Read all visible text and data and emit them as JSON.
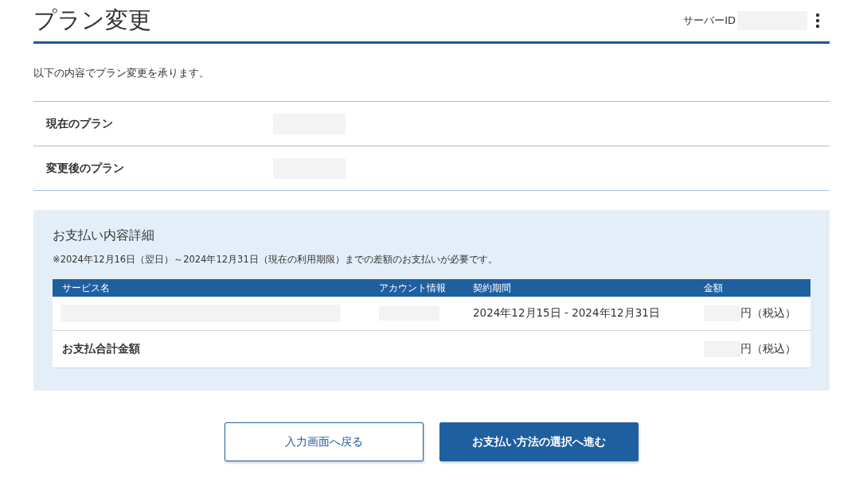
{
  "header": {
    "title": "プラン変更",
    "server_id_label": "サーバーID"
  },
  "intro": "以下の内容でプラン変更を承ります。",
  "plan_rows": [
    {
      "label": "現在のプラン"
    },
    {
      "label": "変更後のプラン"
    }
  ],
  "payment": {
    "title": "お支払い内容詳細",
    "note": "※2024年12月16日（翌日）～2024年12月31日（現在の利用期限）までの差額のお支払いが必要です。",
    "columns": [
      "サービス名",
      "アカウント情報",
      "契約期間",
      "金額"
    ],
    "rows": [
      {
        "period": "2024年12月15日 - 2024年12月31日",
        "amount_suffix": "円（税込）"
      }
    ],
    "total": {
      "label": "お支払合計金額",
      "amount_suffix": "円（税込）"
    }
  },
  "buttons": [
    {
      "label": "入力画面へ戻る",
      "kind": "secondary"
    },
    {
      "label": "お支払い方法の選択へ進む",
      "kind": "primary"
    }
  ]
}
